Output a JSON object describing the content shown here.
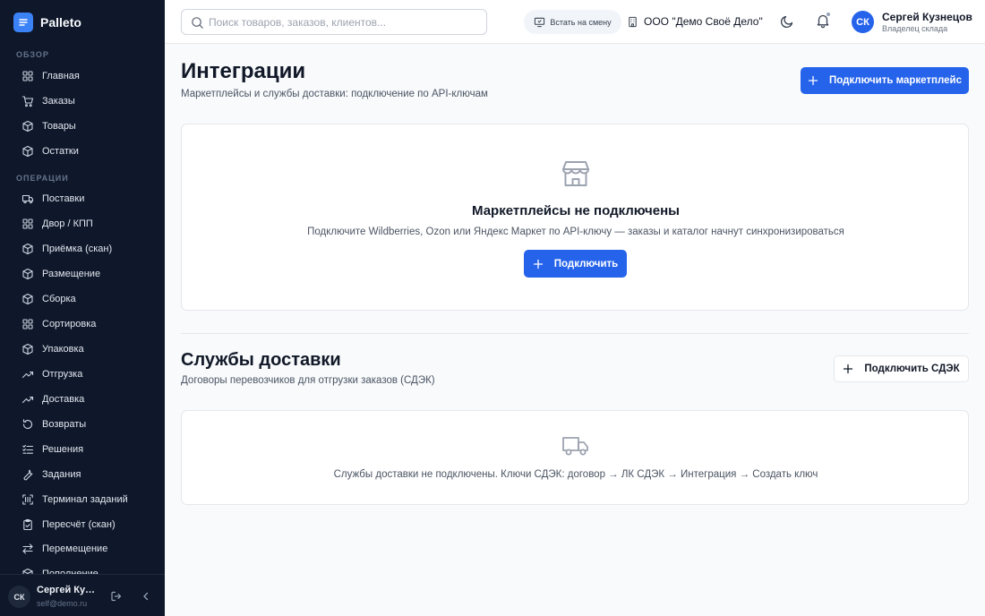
{
  "brand": {
    "name": "Palleto"
  },
  "sidebar": {
    "sections": [
      {
        "label": "ОБЗОР"
      },
      {
        "label": "ОПЕРАЦИИ"
      }
    ],
    "items": [
      {
        "label": "Главная",
        "icon": "grid-icon"
      },
      {
        "label": "Заказы",
        "icon": "cart-icon"
      },
      {
        "label": "Товары",
        "icon": "box-icon"
      },
      {
        "label": "Остатки",
        "icon": "box-icon"
      },
      {
        "label": "Поставки",
        "icon": "truck-icon"
      },
      {
        "label": "Двор / КПП",
        "icon": "grid-icon"
      },
      {
        "label": "Приёмка (скан)",
        "icon": "box-icon"
      },
      {
        "label": "Размещение",
        "icon": "box-icon"
      },
      {
        "label": "Сборка",
        "icon": "box-icon"
      },
      {
        "label": "Сортировка",
        "icon": "grid-icon"
      },
      {
        "label": "Упаковка",
        "icon": "box-icon"
      },
      {
        "label": "Отгрузка",
        "icon": "trend-icon"
      },
      {
        "label": "Доставка",
        "icon": "trend-icon"
      },
      {
        "label": "Возвраты",
        "icon": "rotate-icon"
      },
      {
        "label": "Решения",
        "icon": "checklist-icon"
      },
      {
        "label": "Задания",
        "icon": "wrench-icon"
      },
      {
        "label": "Терминал заданий",
        "icon": "scan-icon"
      },
      {
        "label": "Пересчёт (скан)",
        "icon": "clipboard-icon"
      },
      {
        "label": "Перемещение",
        "icon": "swap-icon"
      },
      {
        "label": "Пополнение",
        "icon": "box-icon"
      }
    ],
    "footer": {
      "initials": "СК",
      "name": "Сергей Кузнецов",
      "email": "self@demo.ru"
    }
  },
  "header": {
    "search_placeholder": "Поиск товаров, заказов, клиентов...",
    "shift_label": "Встать на смену",
    "org_name": "ООО \"Демо Своё Дело\"",
    "user": {
      "initials": "СК",
      "name": "Сергей Кузнецов",
      "role": "Владелец склада"
    }
  },
  "page": {
    "title": "Интеграции",
    "subtitle": "Маркетплейсы и службы доставки: подключение по API-ключам",
    "connect_marketplace_label": "Подключить маркетплейс"
  },
  "marketplaces_empty": {
    "title": "Маркетплейсы не подключены",
    "text": "Подключите Wildberries, Ozon или Яндекс Маркет по API-ключу — заказы и каталог начнут синхронизироваться",
    "button_label": "Подключить"
  },
  "delivery": {
    "title": "Службы доставки",
    "subtitle": "Договоры перевозчиков для отгрузки заказов (СДЭК)",
    "connect_label": "Подключить СДЭК",
    "empty_text": "Службы доставки не подключены. Ключи СДЭК: договор → ЛК СДЭК → Интеграция → Создать ключ"
  },
  "colors": {
    "sidebar_bg": "#0f172a",
    "accent": "#2563eb"
  }
}
